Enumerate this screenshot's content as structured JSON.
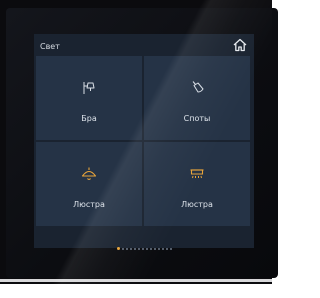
{
  "screen": {
    "title": "Свет"
  },
  "tiles": [
    {
      "label": "Бра",
      "icon": "wall-lamp-icon"
    },
    {
      "label": "Споты",
      "icon": "spotlight-icon"
    },
    {
      "label": "Люстра",
      "icon": "ceiling-lamp-icon"
    },
    {
      "label": "Люстра",
      "icon": "linear-chandelier-icon"
    }
  ],
  "pagination": {
    "pages": 14,
    "active_page": 1
  },
  "colors": {
    "accent": "#e8a43a",
    "tile": "#253346",
    "screen": "#1a2330"
  }
}
